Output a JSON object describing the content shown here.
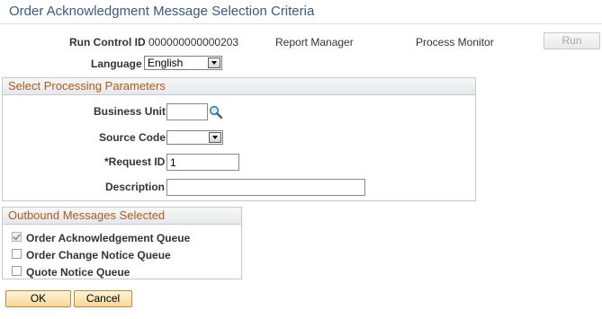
{
  "page": {
    "title": "Order Acknowledgment Message Selection Criteria"
  },
  "header": {
    "run_control_label": "Run Control ID",
    "run_control_value": "000000000000203",
    "report_manager": "Report Manager",
    "process_monitor": "Process Monitor",
    "run_label": "Run",
    "language_label": "Language",
    "language_value": "English"
  },
  "processing": {
    "title": "Select Processing Parameters",
    "business_unit_label": "Business Unit",
    "business_unit_value": "",
    "source_code_label": "Source Code",
    "source_code_value": "",
    "request_id_label": "*Request ID",
    "request_id_value": "1",
    "description_label": "Description",
    "description_value": ""
  },
  "outbound": {
    "title": "Outbound Messages Selected",
    "items": [
      {
        "label": "Order Acknowledgement Queue",
        "checked": true
      },
      {
        "label": "Order Change Notice Queue",
        "checked": false
      },
      {
        "label": "Quote Notice Queue",
        "checked": false
      }
    ]
  },
  "footer": {
    "ok_label": "OK",
    "cancel_label": "Cancel"
  }
}
